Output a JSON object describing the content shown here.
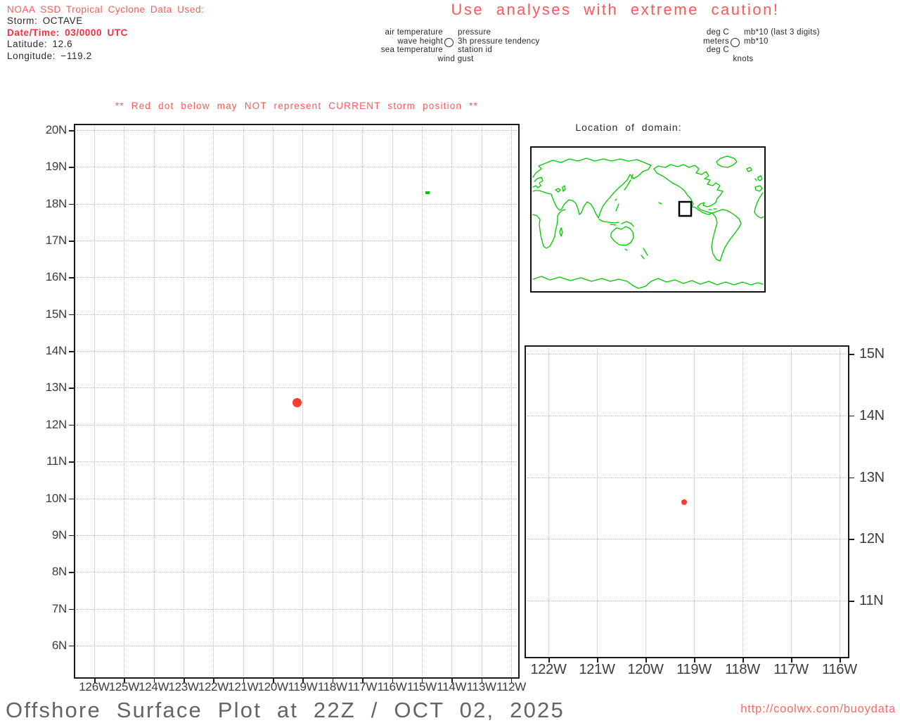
{
  "header": {
    "source_line": "NOAA SSD Tropical Cyclone Data Used:",
    "storm_line": "Storm: OCTAVE",
    "datetime_line": "Date/Time: 03/0000 UTC",
    "latitude_line": "Latitude: 12.6",
    "longitude_line": "Longitude: −119.2"
  },
  "caution_banner": "Use analyses with extreme caution!",
  "station_model_legend": {
    "left_labels": [
      "air temperature",
      "wave height",
      "sea temperature"
    ],
    "right_labels": [
      "pressure",
      "3h pressure tendency",
      "station id"
    ],
    "bottom_label": "wind gust"
  },
  "units_legend": {
    "left_labels": [
      "deg C",
      "meters",
      "deg C"
    ],
    "right_labels": [
      "mb*10 (last 3 digits)",
      "mb*10"
    ],
    "bottom_label": "knots"
  },
  "storm_warning": "** Red dot below may NOT represent CURRENT storm position **",
  "domain_map": {
    "title": "Location of domain:"
  },
  "footer": {
    "title": "Offshore Surface Plot at 22Z / OCT 02, 2025",
    "url": "http://coolwx.com/buoydata"
  },
  "colors": {
    "red_text": "#fa5a5a",
    "red_text_bold": "#f2333f",
    "storm_dot": "#fa3c32",
    "map_outline_green": "#00c800",
    "grid_gray": "#bcbcbc",
    "axis_text": "#3c3c3c",
    "title_gray": "#646464"
  },
  "chart_data": [
    {
      "type": "scatter",
      "name": "offshore-surface-plot-main",
      "title": "Offshore Surface Plot at 22Z / OCT 02, 2025",
      "grid": "dotted",
      "xlim": [
        -126.6,
        -111.8
      ],
      "ylim": [
        5.1,
        20.1
      ],
      "lon_ticks": [
        -126,
        -125,
        -124,
        -123,
        -122,
        -121,
        -120,
        -119,
        -118,
        -117,
        -116,
        -115,
        -114,
        -113,
        -112
      ],
      "lon_tick_labels": [
        "126W",
        "125W",
        "124W",
        "123W",
        "122W",
        "121W",
        "120W",
        "119W",
        "118W",
        "117W",
        "116W",
        "115W",
        "114W",
        "113W",
        "112W"
      ],
      "lat_ticks": [
        20,
        19,
        18,
        17,
        16,
        15,
        14,
        13,
        12,
        11,
        10,
        9,
        8,
        7,
        6
      ],
      "lat_tick_labels": [
        "20N",
        "19N",
        "18N",
        "17N",
        "16N",
        "15N",
        "14N",
        "13N",
        "12N",
        "11N",
        "10N",
        "9N",
        "8N",
        "7N",
        "6N"
      ],
      "series": [
        {
          "name": "storm-position",
          "marker": "dot",
          "size": 13,
          "color": "#fa3c32",
          "points": [
            {
              "lon": -119.2,
              "lat": 12.6
            }
          ]
        },
        {
          "name": "green-mark",
          "marker": "dash",
          "size": 6,
          "color": "#00c800",
          "points": [
            {
              "lon": -114.8,
              "lat": 18.3
            }
          ]
        }
      ]
    },
    {
      "type": "scatter",
      "name": "offshore-surface-plot-zoom",
      "grid": "dotted",
      "xlim": [
        -122.5,
        -116.0
      ],
      "ylim": [
        10.1,
        15.1
      ],
      "lon_ticks": [
        -122,
        -121,
        -120,
        -119,
        -118,
        -117,
        -116
      ],
      "lon_tick_labels": [
        "122W",
        "121W",
        "120W",
        "119W",
        "118W",
        "117W",
        "116W"
      ],
      "lat_ticks": [
        15,
        14,
        13,
        12,
        11
      ],
      "lat_tick_labels": [
        "15N",
        "14N",
        "13N",
        "12N",
        "11N"
      ],
      "series": [
        {
          "name": "storm-position",
          "marker": "dot",
          "size": 8,
          "color": "#fa3c32",
          "points": [
            {
              "lon": -119.2,
              "lat": 12.6
            }
          ]
        }
      ]
    }
  ]
}
